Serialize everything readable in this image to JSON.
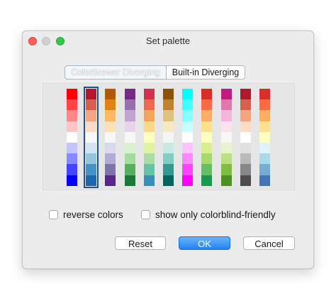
{
  "window": {
    "title": "Set palette"
  },
  "tabs": [
    {
      "label": "ColorBrewer Diverging",
      "selected": true
    },
    {
      "label": "Built-in Diverging",
      "selected": false
    }
  ],
  "palettes": [
    [
      "#ff0000",
      "#ff4444",
      "#ff8888",
      "#ffc4c4",
      "#ffffff",
      "#c4c4ff",
      "#8888ff",
      "#4444ff",
      "#0000ff"
    ],
    [
      "#b2182b",
      "#d6604d",
      "#f4a582",
      "#fddbc7",
      "#f7f7f7",
      "#d1e5f0",
      "#92c5de",
      "#4393c3",
      "#2166ac"
    ],
    [
      "#b35806",
      "#e08214",
      "#fdb863",
      "#fee0b6",
      "#f7f7f7",
      "#d8daeb",
      "#b2abd2",
      "#8073ac",
      "#542788"
    ],
    [
      "#762a83",
      "#9970ab",
      "#c2a5cf",
      "#e7d4e8",
      "#f7f7f7",
      "#d9f0d3",
      "#a6dba0",
      "#5aae61",
      "#1b7837"
    ],
    [
      "#d6304d",
      "#f0664f",
      "#f6a35c",
      "#fbd88a",
      "#fcfec0",
      "#e0f3a1",
      "#a9dca4",
      "#67c2a6",
      "#3990b6"
    ],
    [
      "#8c510a",
      "#bf812d",
      "#dfc27d",
      "#f6e8c3",
      "#f5f5f5",
      "#c7eae5",
      "#80cdc1",
      "#35978f",
      "#01665e"
    ],
    [
      "#00ffff",
      "#44ffff",
      "#88ffff",
      "#c4ffff",
      "#ffffff",
      "#ffc4ff",
      "#ff88ff",
      "#ff44ff",
      "#ff00ff"
    ],
    [
      "#d73027",
      "#f46d43",
      "#fdae61",
      "#fee08b",
      "#ffffbf",
      "#d9ef8b",
      "#a6d96a",
      "#66bd63",
      "#1a9850"
    ],
    [
      "#c51b7d",
      "#de77ae",
      "#f1b6da",
      "#fde0ef",
      "#f7f7f7",
      "#e6f5d0",
      "#b8e186",
      "#7fbc41",
      "#4d9221"
    ],
    [
      "#b2182b",
      "#d6604d",
      "#f4a582",
      "#fddbc7",
      "#ffffff",
      "#e0e0e0",
      "#bababa",
      "#878787",
      "#4d4d4d"
    ],
    [
      "#d73027",
      "#f46d43",
      "#fdae61",
      "#fee090",
      "#ffffbf",
      "#e0f3f8",
      "#abd9e9",
      "#74add1",
      "#4575b4"
    ]
  ],
  "selected_palette_index": 1,
  "options": {
    "reverse_label": "reverse colors",
    "reverse_checked": false,
    "colorblind_label": "show only colorblind-friendly",
    "colorblind_checked": false
  },
  "buttons": {
    "reset": "Reset",
    "ok": "OK",
    "cancel": "Cancel"
  }
}
